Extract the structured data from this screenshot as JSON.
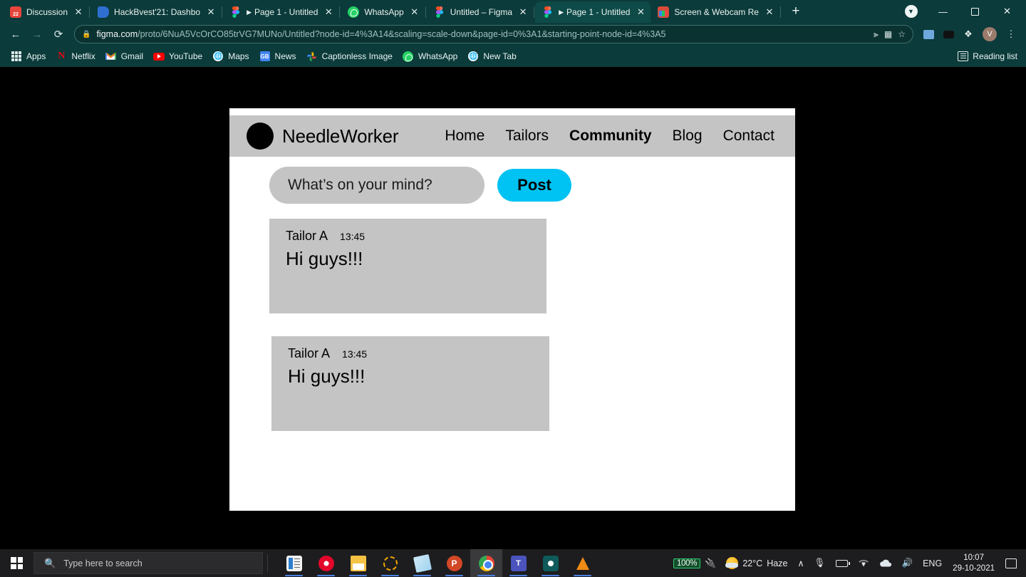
{
  "browser": {
    "tabs": [
      {
        "title": "Discussion",
        "icon": "discussion-favicon",
        "active": false,
        "playing": false
      },
      {
        "title": "HackBvest'21: Dashbo",
        "icon": "hackbvest-favicon",
        "active": false,
        "playing": false
      },
      {
        "title": "Page 1 - Untitled",
        "icon": "figma-favicon",
        "active": false,
        "playing": true
      },
      {
        "title": "WhatsApp",
        "icon": "whatsapp-favicon",
        "active": false,
        "playing": false
      },
      {
        "title": "Untitled – Figma",
        "icon": "figma-favicon",
        "active": false,
        "playing": false
      },
      {
        "title": "Page 1 - Untitled",
        "icon": "figma-favicon",
        "active": true,
        "playing": true
      },
      {
        "title": "Screen & Webcam Re",
        "icon": "screen-recorder-favicon",
        "active": false,
        "playing": false
      }
    ],
    "close_label": "✕",
    "new_tab_label": "+",
    "window_controls": {
      "minimize": "—",
      "maximize": "❐",
      "close": "✕",
      "profile_chevron": "▼"
    },
    "toolbar": {
      "back": "←",
      "forward": "→",
      "reload": "⟳",
      "lock_icon": "🔒",
      "url_domain": "figma.com",
      "url_path": "/proto/6NuA5VcOrCO85trVG7MUNo/Untitled?node-id=4%3A14&scaling=scale-down&page-id=0%3A1&starting-point-node-id=4%3A5",
      "cast_icon": "⧉",
      "qr_icon": "∷",
      "star_icon": "☆",
      "extension_puzzle_icon": "❖",
      "avatar_initial": "V",
      "menu_icon": "⋮"
    },
    "bookmarks": [
      {
        "label": "Apps",
        "icon": "apps-grid-icon"
      },
      {
        "label": "Netflix",
        "icon": "netflix-icon"
      },
      {
        "label": "Gmail",
        "icon": "gmail-icon"
      },
      {
        "label": "YouTube",
        "icon": "youtube-icon"
      },
      {
        "label": "Maps",
        "icon": "maps-icon"
      },
      {
        "label": "News",
        "icon": "news-icon"
      },
      {
        "label": "Captionless Image",
        "icon": "photos-icon"
      },
      {
        "label": "WhatsApp",
        "icon": "whatsapp-icon"
      },
      {
        "label": "New Tab",
        "icon": "newtab-globe-icon"
      }
    ],
    "reading_list": "Reading list"
  },
  "page": {
    "header": {
      "brand": "NeedleWorker",
      "logo_icon": "circle-logo",
      "nav": [
        {
          "label": "Home",
          "active": false
        },
        {
          "label": "Tailors",
          "active": false
        },
        {
          "label": "Community",
          "active": true
        },
        {
          "label": "Blog",
          "active": false
        },
        {
          "label": "Contact",
          "active": false
        }
      ]
    },
    "composer": {
      "placeholder": "What’s on your mind?",
      "post_button": "Post",
      "accent_color": "#00C2F3"
    },
    "posts": [
      {
        "author": "Tailor A",
        "time": "13:45",
        "body": "Hi guys!!!"
      },
      {
        "author": "Tailor A",
        "time": "13:45",
        "body": "Hi guys!!!"
      }
    ]
  },
  "taskbar": {
    "start_icon": "windows-logo-icon",
    "search_placeholder": "Type here to search",
    "search_icon": "search-icon",
    "apps": [
      {
        "name": "news-and-interests",
        "running": true,
        "active": false
      },
      {
        "name": "opera-browser",
        "running": true,
        "active": false
      },
      {
        "name": "file-explorer",
        "running": true,
        "active": false
      },
      {
        "name": "loading-app",
        "running": true,
        "active": false
      },
      {
        "name": "onenote",
        "running": true,
        "active": false
      },
      {
        "name": "powerpoint",
        "running": true,
        "active": false
      },
      {
        "name": "google-chrome",
        "running": true,
        "active": true
      },
      {
        "name": "microsoft-teams",
        "running": true,
        "active": false
      },
      {
        "name": "screen-recorder",
        "running": true,
        "active": false
      },
      {
        "name": "vlc-media-player",
        "running": true,
        "active": false
      }
    ],
    "battery_percent": "100%",
    "plug_icon": "⚡",
    "tray": {
      "weather_temp": "22°C",
      "weather_desc": "Haze",
      "chevron": "∧",
      "mic_icon": "🎙",
      "battery_icon": "battery-icon",
      "wifi_icon": "wifi-icon",
      "cloud_icon": "onedrive-icon",
      "volume_icon": "🔊",
      "language": "ENG",
      "time": "10:07",
      "date": "29-10-2021",
      "notification_icon": "action-center-icon"
    }
  }
}
